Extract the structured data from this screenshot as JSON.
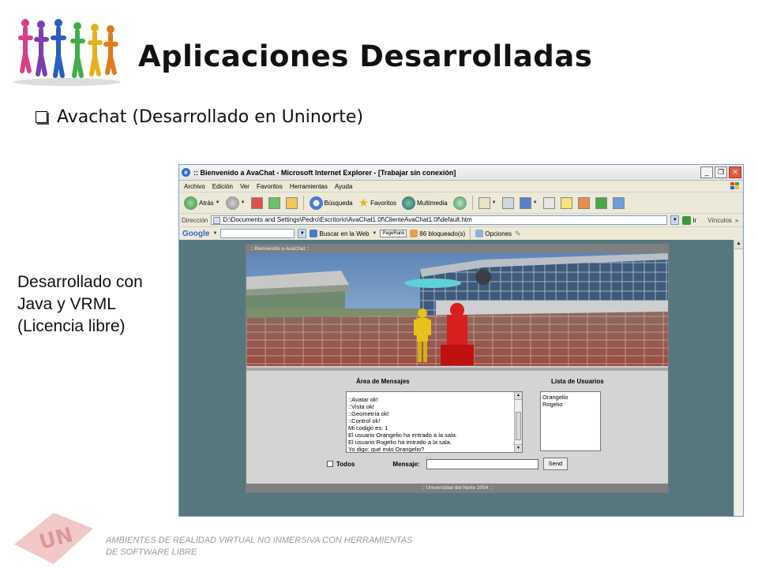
{
  "slide": {
    "title": "Aplicaciones Desarrolladas",
    "bullet": "Avachat (Desarrollado en Uninorte)",
    "side_note": [
      "Desarrollado con",
      "Java y VRML",
      "(Licencia libre)"
    ],
    "footer": [
      "AMBIENTES DE REALIDAD VIRTUAL NO INMERSIVA CON HERRAMIENTAS",
      "DE SOFTWARE LIBRE"
    ]
  },
  "browser": {
    "title": ":: Bienvenido a AvaChat - Microsoft Internet Explorer - [Trabajar sin conexión]",
    "window_buttons": [
      "_",
      "❐",
      "✕"
    ],
    "menu": [
      "Archivo",
      "Edición",
      "Ver",
      "Favoritos",
      "Herramientas",
      "Ayuda"
    ],
    "toolbar": {
      "back": "Atrás",
      "search": "Búsqueda",
      "favorites": "Favoritos",
      "multimedia": "Multimedia"
    },
    "address": {
      "label": "Dirección",
      "value": "D:\\Documents and Settings\\Pedro\\Escritorio\\AvaChat1.0f\\ClienteAvaChat1.0f\\default.htm",
      "go": "Ir",
      "links": "Vínculos"
    },
    "googlebar": {
      "logo": "Google",
      "search_web": "Buscar en la Web",
      "pagerank": "PageRank",
      "blocked": "86 bloqueado(s)",
      "options": "Opciones"
    }
  },
  "app": {
    "header": ":: Bienvenido a AvaChat ::",
    "messages_label": "Área de Mensajes",
    "users_label": "Lista de Usuarios",
    "messages": [
      "::Avatar ok!",
      "::Vista ok!",
      "::Geometría ok!",
      "::Control ok!",
      "Mi codigo es: 1",
      "El usuario Orangelio ha entrado a la sala.",
      "El usuario Rogelio ha entrado a la sala.",
      "Yo digo: qué más Orangelio?"
    ],
    "users": [
      "Orangelio",
      "Rogelio"
    ],
    "all_label": "Todos",
    "message_label": "Mensaje:",
    "send_label": "Send",
    "footer": ":: Universidad del Norte 2004 ::"
  },
  "colors": {
    "page_bg": "#57777f",
    "app_bar": "#7f7f7f",
    "panel": "#d4d4d4"
  }
}
